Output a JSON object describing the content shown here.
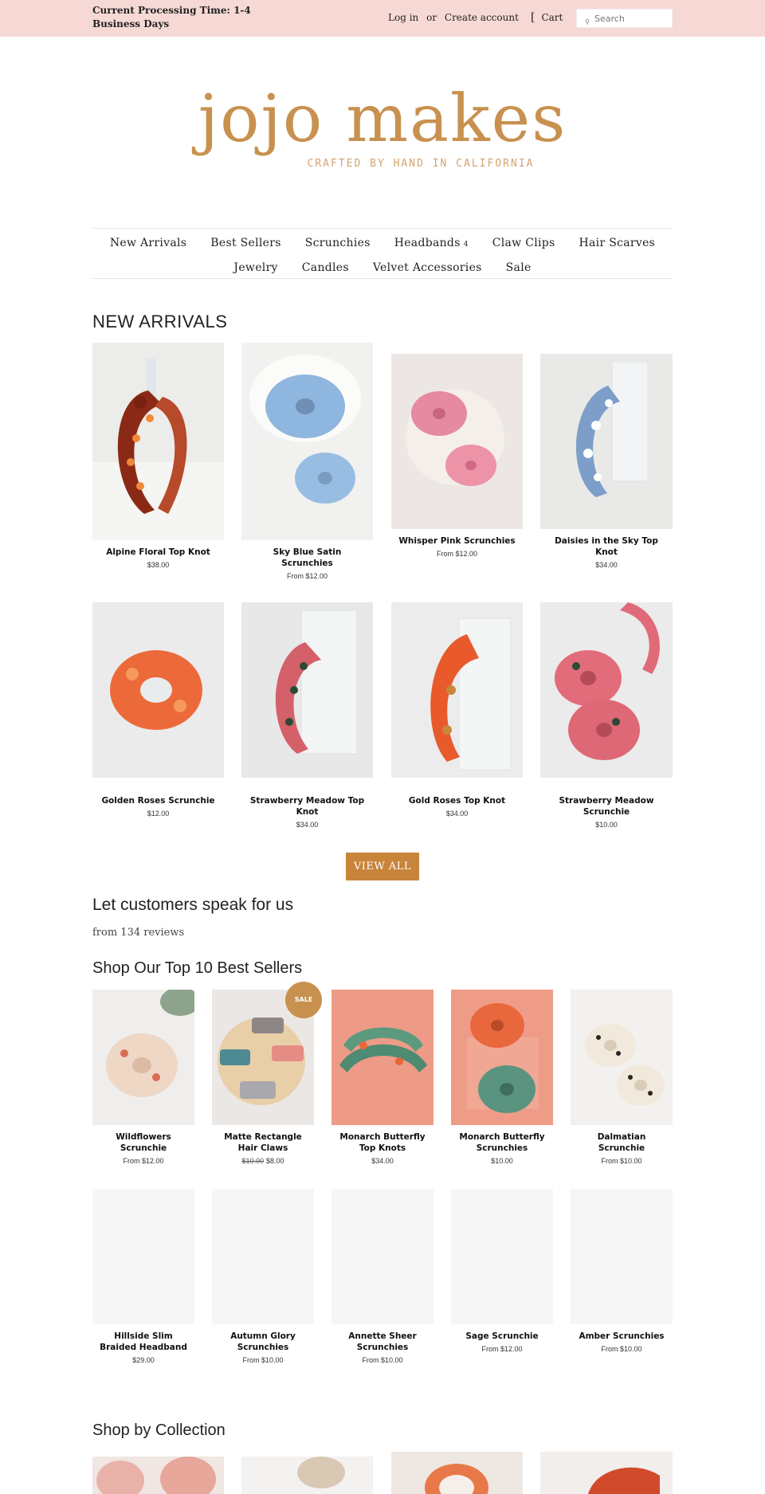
{
  "topbar": {
    "notice": "Current Processing Time: 1-4 Business Days",
    "login": "Log in",
    "or": "or",
    "create_account": "Create account",
    "cart_bracket": "[",
    "cart": "Cart",
    "search_placeholder": "Search",
    "search_icon": "magnifier-icon"
  },
  "logo": {
    "brand": "jojo makes",
    "tagline": "CRAFTED BY HAND IN CALIFORNIA"
  },
  "nav": {
    "row1": [
      "New Arrivals",
      "Best Sellers",
      "Scrunchies",
      "Headbands",
      "Claw Clips",
      "Hair Scarves"
    ],
    "row2": [
      "Jewelry",
      "Candles",
      "Velvet Accessories",
      "Sale"
    ],
    "caret": "4"
  },
  "new_arrivals": {
    "heading": "NEW ARRIVALS",
    "products": [
      {
        "title": "Alpine Floral Top Knot",
        "price": "$38.00"
      },
      {
        "title": "Sky Blue Satin Scrunchies",
        "price": "From $12.00"
      },
      {
        "title": "Whisper Pink Scrunchies",
        "price": "From $12.00"
      },
      {
        "title": "Daisies in the Sky Top Knot",
        "price": "$34.00"
      },
      {
        "title": "Golden Roses Scrunchie",
        "price": "$12.00"
      },
      {
        "title": "Strawberry Meadow Top Knot",
        "price": "$34.00"
      },
      {
        "title": "Gold Roses Top Knot",
        "price": "$34.00"
      },
      {
        "title": "Strawberry Meadow Scrunchie",
        "price": "$10.00"
      }
    ],
    "view_all": "VIEW ALL"
  },
  "customers": {
    "heading": "Let customers speak for us",
    "reviews": "from 134 reviews"
  },
  "best_sellers": {
    "heading": "Shop Our Top 10 Best Sellers",
    "sale_badge": "SALE",
    "products": [
      {
        "title": "Wildflowers Scrunchie",
        "price": "From $12.00"
      },
      {
        "title": "Matte Rectangle Hair Claws",
        "old_price": "$10.00",
        "price": "$8.00"
      },
      {
        "title": "Monarch Butterfly Top Knots",
        "price": "$34.00"
      },
      {
        "title": "Monarch Butterfly Scrunchies",
        "price": "$10.00"
      },
      {
        "title": "Dalmatian Scrunchie",
        "price": "From $10.00"
      },
      {
        "title": "Hillside Slim Braided Headband",
        "price": "$29.00"
      },
      {
        "title": "Autumn Glory Scrunchies",
        "price": "From $10.00"
      },
      {
        "title": "Annette Sheer Scrunchies",
        "price": "From $10.00"
      },
      {
        "title": "Sage Scrunchie",
        "price": "From $12.00"
      },
      {
        "title": "Amber Scrunchies",
        "price": "From $10.00"
      }
    ]
  },
  "collections": {
    "heading": "Shop by Collection"
  },
  "colors": {
    "topbar_bg": "#f6d9d5",
    "brand": "#c8914f",
    "button": "#c8843a"
  }
}
